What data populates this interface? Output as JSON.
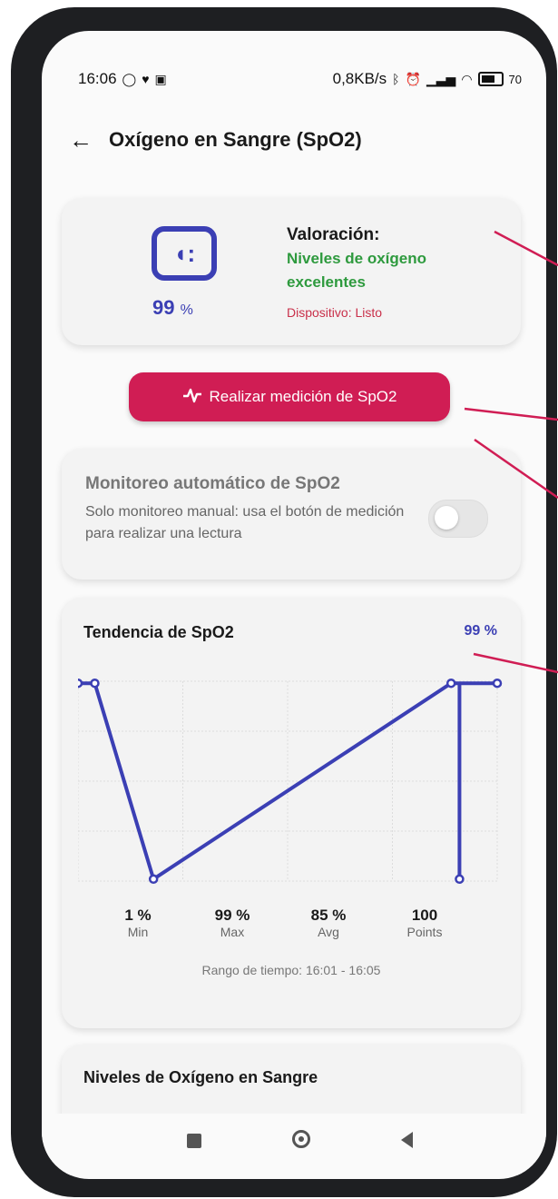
{
  "status_bar": {
    "time": "16:06",
    "left_icons": [
      "whatsapp-icon",
      "heart-icon",
      "mail-icon"
    ],
    "speed": "0,8KB/s",
    "right_icons": [
      "bluetooth-icon",
      "alarm-icon",
      "signal-icon",
      "wifi-icon",
      "battery-icon"
    ],
    "battery": "70"
  },
  "app_bar": {
    "back_icon": "arrow-left-icon",
    "title": "Oxígeno en Sangre (SpO2)"
  },
  "assessment_card": {
    "value": "99",
    "unit": "%",
    "label": "Valoración:",
    "status": "Niveles de oxígeno excelentes",
    "device": "Dispositivo: Listo",
    "status_color": "#2e9a3e",
    "device_color": "#c9304a",
    "accent_color": "#3b3fb4"
  },
  "measure_button": {
    "label": "Realizar medición de SpO2",
    "icon": "pulse-icon",
    "color": "#d01d54"
  },
  "auto_monitor": {
    "title": "Monitoreo automático de SpO2",
    "description": "Solo monitoreo manual: usa el botón de medición para realizar una lectura",
    "enabled": false
  },
  "trend": {
    "title": "Tendencia de SpO2",
    "current": "99 %",
    "stats": [
      {
        "value": "1 %",
        "label": "Min"
      },
      {
        "value": "99 %",
        "label": "Max"
      },
      {
        "value": "85 %",
        "label": "Avg"
      },
      {
        "value": "100",
        "label": "Points"
      }
    ],
    "range": "Rango de tiempo: 16:01 - 16:05"
  },
  "chart_data": {
    "type": "line",
    "series": [
      {
        "x": [
          0,
          4,
          18,
          89,
          91,
          91,
          91,
          95,
          100
        ],
        "values": [
          99,
          99,
          1,
          99,
          99,
          1,
          99,
          99,
          99
        ]
      }
    ],
    "xlim": [
      0,
      100
    ],
    "ylim": [
      0,
      100
    ],
    "grid": true,
    "color": "#3b3fb4"
  },
  "levels_card": {
    "title": "Niveles de Oxígeno en Sangre"
  },
  "nav_bar": {
    "icons": [
      "recents-icon",
      "home-icon",
      "back-icon"
    ]
  }
}
